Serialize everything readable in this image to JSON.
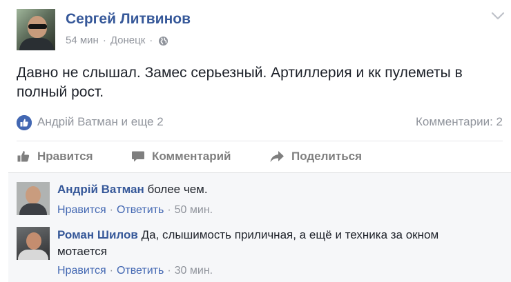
{
  "post": {
    "author": "Сергей Литвинов",
    "time": "54 мин",
    "location": "Донецк",
    "text": "Давно не слышал. Замес серьезный. Артиллерия и кк пулеметы в полный рост.",
    "likers": "Андрій Ватман и еще 2",
    "comments_count": "Комментарии: 2",
    "icons": {
      "privacy": "globe-icon",
      "menu": "chevron-down-icon",
      "reaction": "thumbs-up-icon"
    }
  },
  "actions": {
    "like": "Нравится",
    "comment": "Комментарий",
    "share": "Поделиться"
  },
  "comments": [
    {
      "author": "Андрій Ватман",
      "text": "более чем.",
      "like_label": "Нравится",
      "reply_label": "Ответить",
      "time": "50 мин."
    },
    {
      "author": "Роман Шилов",
      "text": "Да, слышимость приличная, а ещё и техника за окном мотается",
      "like_label": "Нравится",
      "reply_label": "Ответить",
      "time": "30 мин."
    }
  ],
  "colors": {
    "link": "#365899",
    "meta": "#90949c",
    "action": "#7f7f7f",
    "reaction_badge": "#4267b2",
    "comments_bg": "#f6f7f9"
  }
}
